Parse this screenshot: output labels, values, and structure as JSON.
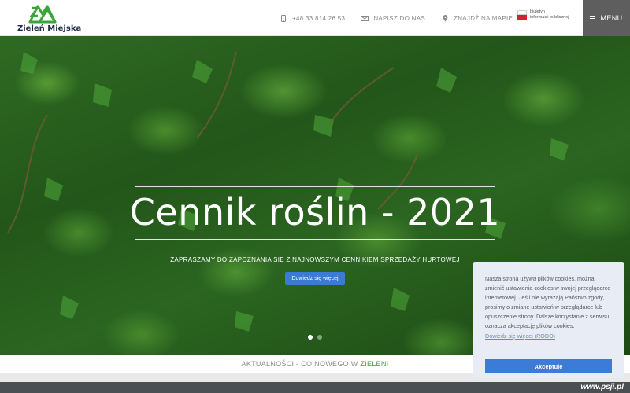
{
  "brand": {
    "name": "Zieleń Miejska",
    "color": "#3aa53a"
  },
  "header": {
    "phone": "+48 33 814 26 53",
    "email_label": "NAPISZ DO NAS",
    "map_label": "ZNAJDŹ NA MAPIE",
    "bip_line1": "biuletyn",
    "bip_line2": "informacji publicznej",
    "menu_label": "MENU",
    "icons": {
      "phone": "phone-icon",
      "email": "envelope-icon",
      "map": "map-pin-icon",
      "menu": "hamburger-icon",
      "bip": "bip-flag-icon"
    }
  },
  "hero": {
    "title": "Cennik roślin - 2021",
    "subtitle": "ZAPRASZAMY DO ZAPOZNANIA SIĘ Z NAJNOWSZYM CENNIKIEM SPRZEDAŻY HURTOWEJ",
    "button_label": "Dowiedz się więcej",
    "slides": [
      {
        "active": true
      },
      {
        "active": false
      }
    ],
    "accent": "#3a7bd5"
  },
  "news": {
    "title_prefix": "AKTUALNOŚCI - CO NOWEGO W ",
    "title_highlight": "ZIELENI",
    "highlight_color": "#3d9a3d"
  },
  "cookie": {
    "text": "Nasza strona używa plików cookies, można zmienić ustawienia cookies w swojej przeglądarce internetowej. Jeśli nie wyrażają Państwo zgody, prosimy o zmianę ustawień w przeglądarce lub opuszczenie strony. Dalsze korzystanie z serwisu oznacza akceptację plików cookies.",
    "link_label": "Dowiedz się więcej (RODO)",
    "accept_label": "Akceptuje",
    "button_color": "#3d7bd8"
  },
  "watermark": "www.psji.pl"
}
